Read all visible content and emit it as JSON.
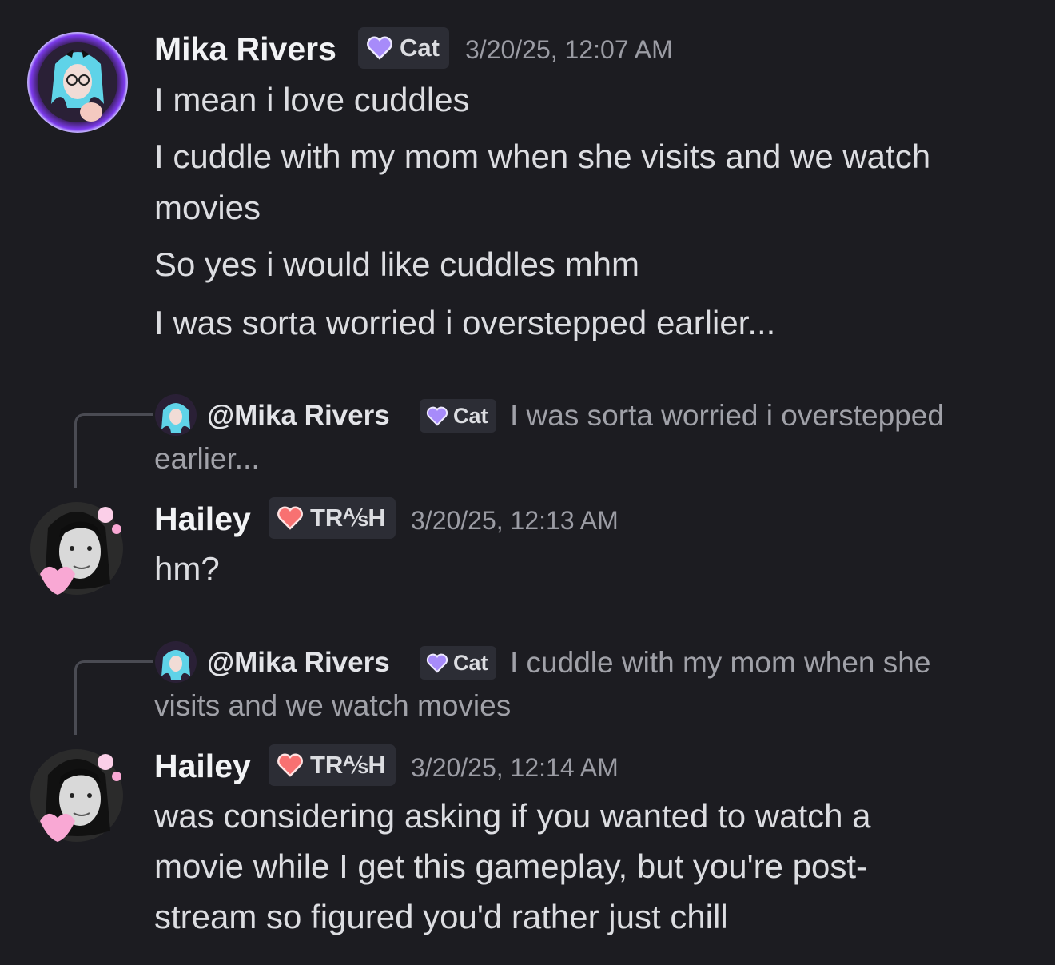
{
  "messages": [
    {
      "author": "Mika Rivers",
      "role": "Cat",
      "role_color": "#a78bfa",
      "timestamp": "3/20/25, 12:07 AM",
      "lines": [
        "I mean i love cuddles",
        "I cuddle with my mom when she visits and we watch",
        "movies",
        "So yes i would like cuddles mhm",
        "I was sorta worried i overstepped earlier..."
      ]
    },
    {
      "reply": {
        "mention": "@Mika Rivers",
        "role": "Cat",
        "text_line1": "I was sorta worried i overstepped",
        "text_line2": "earlier..."
      },
      "author": "Hailey",
      "role": "TR⅍H",
      "role_color": "#f87171",
      "timestamp": "3/20/25, 12:13 AM",
      "lines": [
        "hm?"
      ]
    },
    {
      "reply": {
        "mention": "@Mika Rivers",
        "role": "Cat",
        "text_line1": "I cuddle with my mom when she",
        "text_line2": "visits and we watch movies"
      },
      "author": "Hailey",
      "role": "TR⅍H",
      "role_color": "#f87171",
      "timestamp": "3/20/25, 12:14 AM",
      "lines": [
        "was considering asking if you wanted to watch a",
        "movie while I get this gameplay, but you're post-",
        "stream so figured you'd rather just chill"
      ]
    }
  ],
  "colors": {
    "background": "#1c1c21",
    "text": "#dcdde1",
    "muted": "#9b9ca4",
    "tag_bg": "#2c2d35"
  },
  "icons": {
    "avatar_mika": "anime-avatar-icon",
    "avatar_hailey": "photo-avatar-icon",
    "role_heart": "heart-icon"
  }
}
